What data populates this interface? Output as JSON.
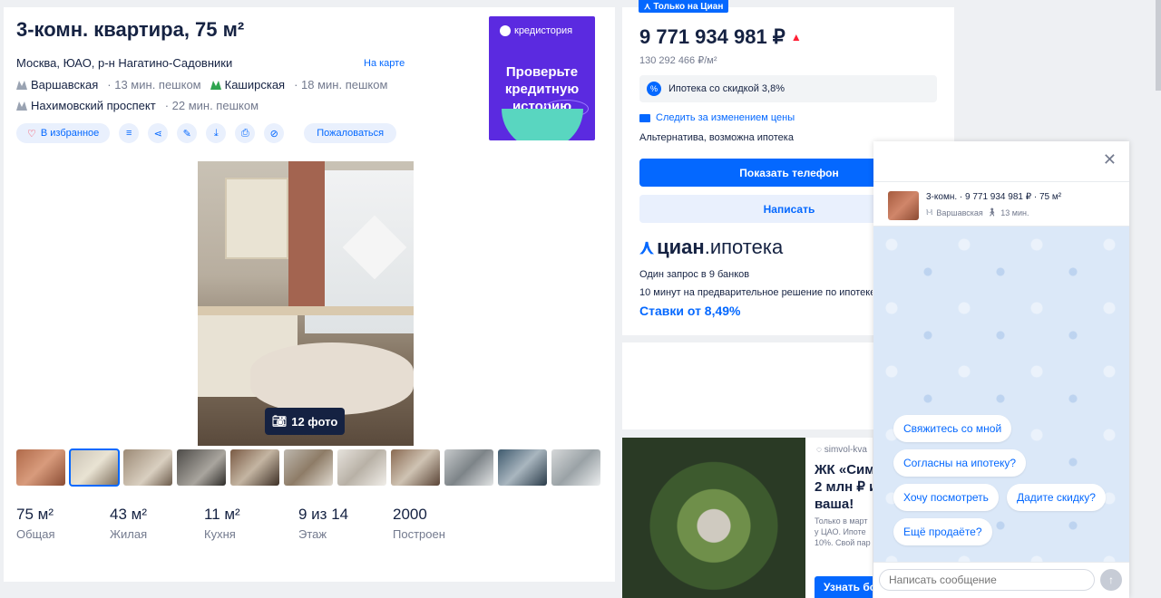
{
  "listing": {
    "title": "3-комн. квартира, 75 м²",
    "address": "Москва, ЮАО, р-н Нагатино-Садовники",
    "map_link": "На карте",
    "metro": [
      {
        "name": "Варшавская",
        "walk": "· 13 мин. пешком",
        "color": "#9aa3b2"
      },
      {
        "name": "Каширская",
        "walk": "· 18 мин. пешком",
        "color": "#2ea44f"
      },
      {
        "name": "Нахимовский проспект",
        "walk": "· 22 мин. пешком",
        "color": "#9aa3b2"
      }
    ],
    "actions": {
      "favorite": "В избранное",
      "complain": "Пожаловаться"
    },
    "photo_count": "12 фото",
    "stats": [
      {
        "value": "75 м²",
        "label": "Общая"
      },
      {
        "value": "43 м²",
        "label": "Жилая"
      },
      {
        "value": "11 м²",
        "label": "Кухня"
      },
      {
        "value": "9 из 14",
        "label": "Этаж"
      },
      {
        "value": "2000",
        "label": "Построен"
      }
    ]
  },
  "ad_top": {
    "brand": "кредистория",
    "text": "Проверьте кредитную историю"
  },
  "price_card": {
    "badge": "Только на Циан",
    "price": "9 771 934 981 ₽",
    "per_meter": "130 292 466 ₽/м²",
    "mortgage": "Ипотека со скидкой 3,8%",
    "follow": "Следить за изменением цены",
    "alt": "Альтернатива, возможна ипотека",
    "phone_btn": "Показать телефон",
    "write_btn": "Написать",
    "cian_logo_a": "циан",
    "cian_logo_b": ".ипотека",
    "cian_line1": "Один запрос в 9 банков",
    "cian_line2": "10 минут на предварительное решение по ипотеке",
    "cian_rate": "Ставки от 8,49%"
  },
  "ad_bottom": {
    "domain": "simvol-kva",
    "headline_1": "ЖК «Сим",
    "headline_2": "2 млн ₽ и",
    "headline_3": "ваша!",
    "body_1": "Только в март",
    "body_2": "у ЦАО. Ипоте",
    "body_3": "10%. Свой пар",
    "cta": "Узнать бо"
  },
  "chat": {
    "listing_title": "3-комн. · 9 771 934 981 ₽ · 75 м²",
    "metro": "Варшавская",
    "walk": "13 мин.",
    "chips": [
      "Свяжитесь со мной",
      "Согласны на ипотеку?",
      "Хочу посмотреть",
      "Дадите скидку?",
      "Ещё продаёте?"
    ],
    "input_placeholder": "Написать сообщение"
  }
}
